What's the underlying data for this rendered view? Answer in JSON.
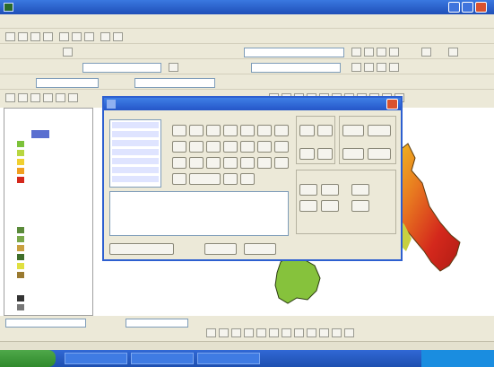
{
  "app": {
    "title": "",
    "colors": {
      "titlebar": "#2a5fd0",
      "chrome": "#ece9d8",
      "taskbar": "#245edb",
      "start": "#3c9a36",
      "raster_high": "#d4281c",
      "raster_mid": "#f0a020",
      "raster_low": "#7cc23a"
    }
  },
  "menu": {
    "items": [
      "",
      "",
      "",
      "",
      "",
      "",
      "",
      ""
    ]
  },
  "toolbar": {
    "field_1": "",
    "field_2": "",
    "field_3": "",
    "field_4": "",
    "field_5": ""
  },
  "toc": {
    "items": [
      "",
      "",
      "",
      "",
      "",
      "",
      "",
      "",
      "",
      "",
      "",
      "",
      "",
      "",
      "",
      "",
      "",
      "",
      "",
      ""
    ]
  },
  "dialog": {
    "title": "",
    "layers_label": "",
    "operators": [
      "",
      "",
      "",
      "",
      "",
      "",
      "",
      "",
      "",
      "",
      "",
      "",
      "",
      "",
      "",
      "",
      "",
      "",
      "",
      "",
      "",
      "",
      "",
      "",
      ""
    ],
    "arithmetic_label": "",
    "math_label": "",
    "logical_label": "",
    "functions": [
      "",
      "",
      "",
      "",
      "",
      "",
      "",
      "",
      "",
      "",
      "",
      "",
      "",
      ""
    ],
    "expression": "",
    "about_button": "",
    "evaluate_button": "",
    "cancel_button": ""
  },
  "status": {
    "left_field": "",
    "right_field": ""
  },
  "taskbar": {
    "start_label": "",
    "tasks": [
      "",
      "",
      ""
    ],
    "clock": ""
  }
}
